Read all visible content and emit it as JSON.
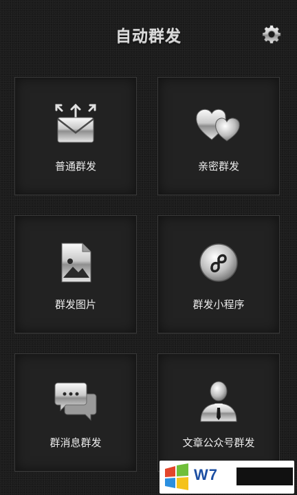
{
  "header": {
    "title": "自动群发",
    "settings_icon": "gear-icon"
  },
  "tiles": [
    {
      "label": "普通群发",
      "icon": "envelope-broadcast-icon"
    },
    {
      "label": "亲密群发",
      "icon": "hearts-icon"
    },
    {
      "label": "群发图片",
      "icon": "image-file-icon"
    },
    {
      "label": "群发小程序",
      "icon": "mini-program-icon"
    },
    {
      "label": "群消息群发",
      "icon": "chat-bubbles-icon"
    },
    {
      "label": "文章公众号群发",
      "icon": "official-account-person-icon"
    }
  ],
  "watermark": {
    "text": "W7",
    "icon": "windows-logo-icon"
  },
  "colors": {
    "background": "#1c1c1c",
    "tile": "#222222",
    "metal_light": "#f4f4f4",
    "metal_dark": "#6e6e6e"
  }
}
